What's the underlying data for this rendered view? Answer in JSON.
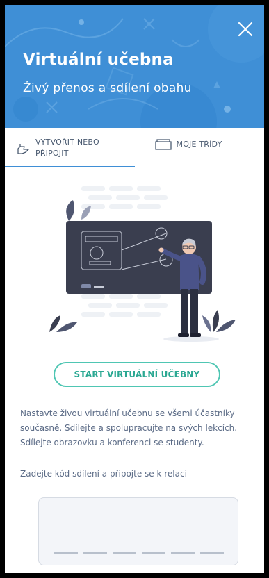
{
  "header": {
    "title": "Virtuální učebna",
    "subtitle": "Živý přenos a sdílení obahu",
    "bg_color": "#3f8fd6"
  },
  "tabs": [
    {
      "label_line1": "VYTVOŘIT NEBO",
      "label_line2": "PŘIPOJIT",
      "icon": "pointing-hand-icon",
      "active": true
    },
    {
      "label": "MOJE TŘÍDY",
      "icon": "folder-icon",
      "active": false
    }
  ],
  "main": {
    "start_button": "START VIRTUÁLNÍ UČEBNY",
    "description": "Nastavte živou virtuální učebnu se všemi účastníky současně. Sdílejte a spolupracujte na svých lekcích. Sdílejte obrazovku a konferenci se studenty.",
    "code_prompt": "Zadejte kód sdílení a připojte se k relaci",
    "code_slots": 6,
    "accent_color": "#4fc6b3"
  }
}
